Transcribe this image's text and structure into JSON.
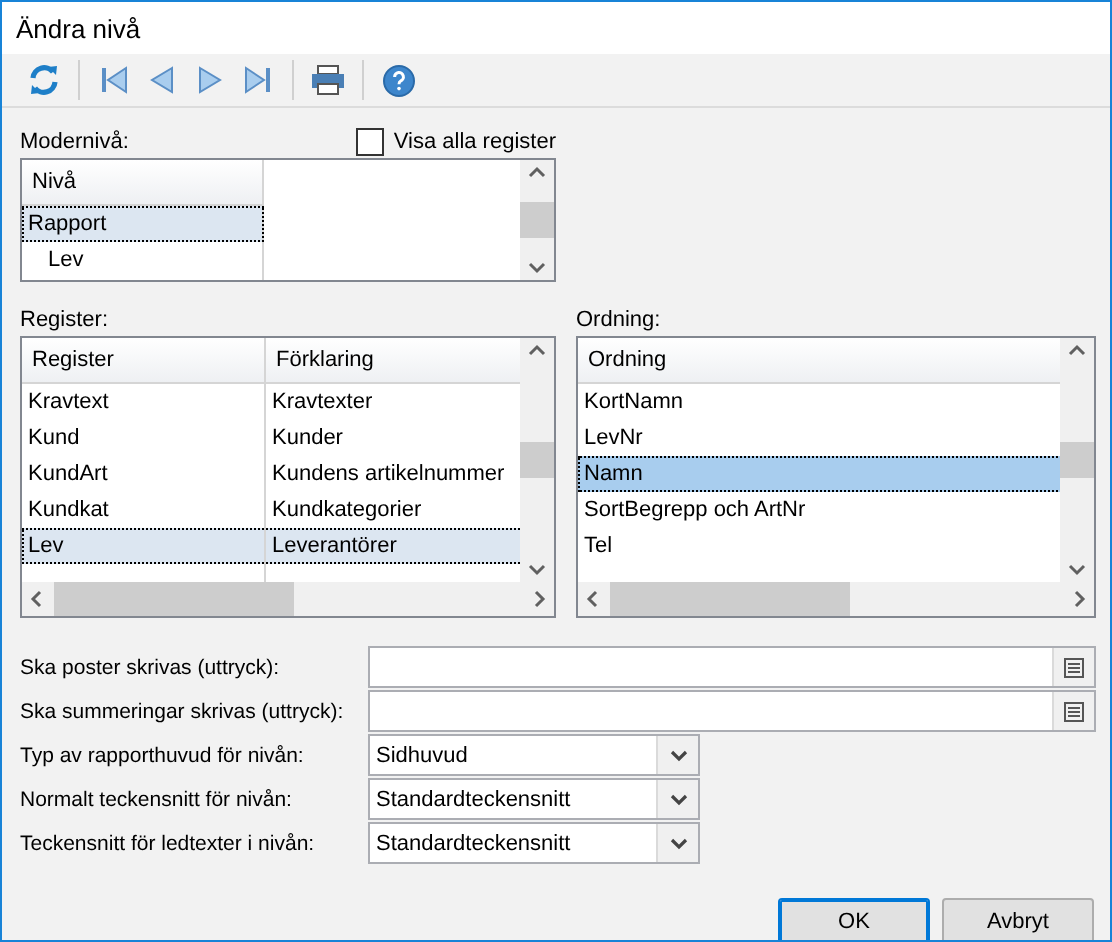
{
  "window": {
    "title": "Ändra nivå"
  },
  "parent_level": {
    "label": "Modernivå:",
    "show_all": {
      "label": "Visa alla register",
      "checked": false
    },
    "active": false,
    "columns": [
      "Nivå"
    ],
    "rows": [
      {
        "name": "Rapport",
        "selected": true,
        "children": [
          {
            "name": "Lev",
            "selected": false
          }
        ]
      }
    ]
  },
  "register": {
    "label": "Register:",
    "active": false,
    "columns": [
      "Register",
      "Förklaring"
    ],
    "rows": [
      {
        "cells": [
          "Kravtext",
          "Kravtexter"
        ],
        "selected": false
      },
      {
        "cells": [
          "Kund",
          "Kunder"
        ],
        "selected": false
      },
      {
        "cells": [
          "KundArt",
          "Kundens artikelnummer"
        ],
        "selected": false
      },
      {
        "cells": [
          "Kundkat",
          "Kundkategorier"
        ],
        "selected": false
      },
      {
        "cells": [
          "Lev",
          "Leverantörer"
        ],
        "selected": true
      }
    ]
  },
  "order": {
    "label": "Ordning:",
    "active": true,
    "columns": [
      "Ordning"
    ],
    "rows": [
      {
        "cells": [
          "KortNamn"
        ],
        "selected": false
      },
      {
        "cells": [
          "LevNr"
        ],
        "selected": false
      },
      {
        "cells": [
          "Namn"
        ],
        "selected": true
      },
      {
        "cells": [
          "SortBegrepp och ArtNr"
        ],
        "selected": false
      },
      {
        "cells": [
          "Tel"
        ],
        "selected": false
      }
    ]
  },
  "fields": [
    {
      "kind": "expression",
      "label": "Ska poster skrivas (uttryck):"
    },
    {
      "kind": "expression",
      "label": "Ska summeringar skrivas (uttryck):"
    },
    {
      "kind": "combo",
      "label": "Typ av rapporthuvud för nivån:",
      "value": "Sidhuvud"
    },
    {
      "kind": "combo",
      "label": "Normalt teckensnitt för nivån:",
      "value": "Standardteckensnitt"
    },
    {
      "kind": "combo",
      "label": "Teckensnitt för ledtexter i nivån:",
      "value": "Standardteckensnitt"
    }
  ],
  "buttons": [
    {
      "label": "OK",
      "default": true
    },
    {
      "label": "Avbryt",
      "default": false
    }
  ]
}
